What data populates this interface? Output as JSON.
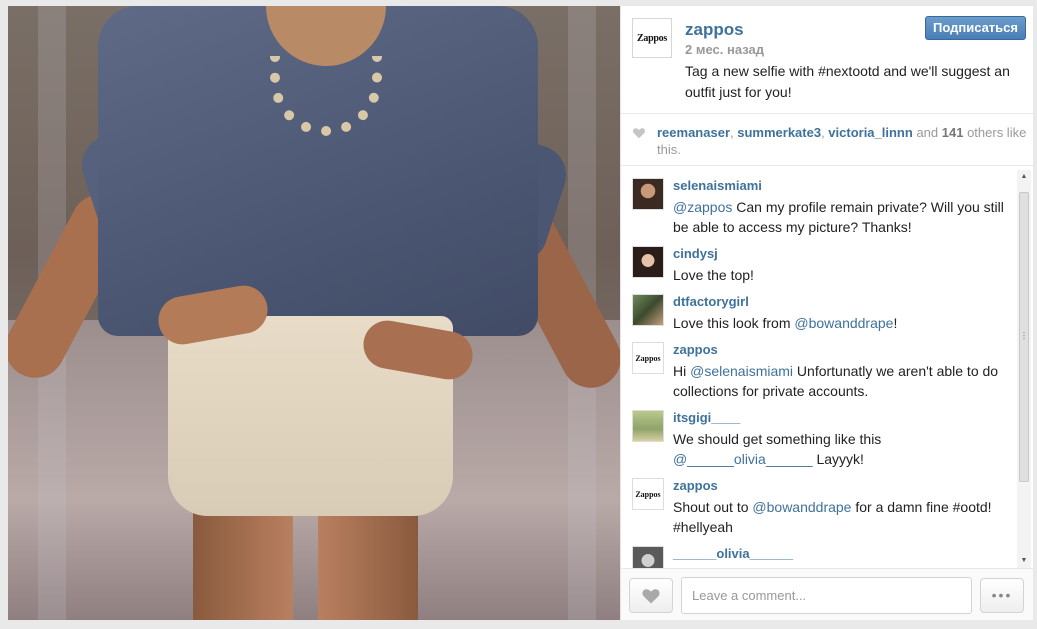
{
  "post": {
    "owner": {
      "username": "zappos",
      "avatar_icon": "zappos-logo-icon",
      "avatar_logo_text": "Zappos"
    },
    "follow_label": "Подписаться",
    "time_ago": "2 мес. назад",
    "caption": "Tag a new selfie with #nextootd and we'll suggest an outfit just for you!",
    "photo_icon": "outfit-photo"
  },
  "likes": {
    "heart_icon": "heart-icon",
    "users": [
      "reemanaser",
      "summerkate3",
      "victoria_linnn"
    ],
    "sep1": ", ",
    "sep2": ", ",
    "and_text": " and ",
    "count": "141",
    "suffix": " others like this."
  },
  "comments": [
    {
      "username": "selenaismiami",
      "mention": "@zappos",
      "text": " Can my profile remain private? Will you still be able to access my picture? Thanks!"
    },
    {
      "username": "cindysj",
      "text": "Love the top!"
    },
    {
      "username": "dtfactorygirl",
      "text_before": "Love this look from ",
      "mention": "@bowanddrape",
      "text_after": "!"
    },
    {
      "username": "zappos",
      "text_before": "Hi ",
      "mention": "@selenaismiami",
      "text_after": " Unfortunatly we aren't able to do collections for private accounts."
    },
    {
      "username": "itsgigi____",
      "text_before": "We should get something like this ",
      "mention": "@______olivia______",
      "text_after": " Layyyk!"
    },
    {
      "username": "zappos",
      "text_before": "Shout out to ",
      "mention": "@bowanddrape",
      "text_after": " for a damn fine #ootd! #hellyeah"
    },
    {
      "username": "______olivia______"
    }
  ],
  "footer": {
    "comment_placeholder": "Leave a comment...",
    "more_label": "•••"
  },
  "colors": {
    "link": "#3f729b",
    "follow_button": "#4a7eb5",
    "meta_gray": "#999999"
  }
}
